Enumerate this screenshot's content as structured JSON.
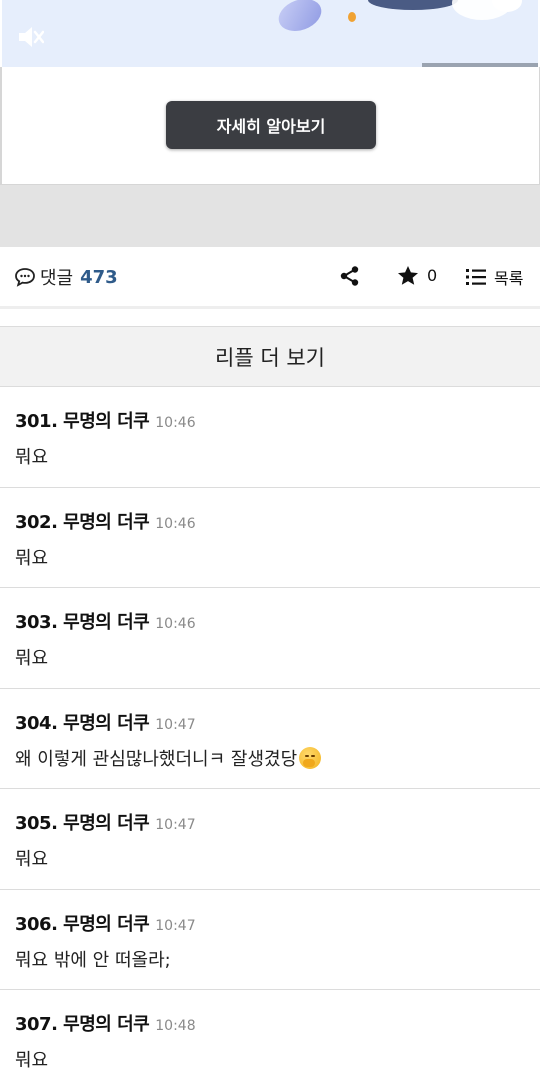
{
  "ad": {
    "button_label": "자세히 알아보기",
    "mute_icon": "mute-icon"
  },
  "toolbar": {
    "comment_label": "댓글",
    "comment_count": "473",
    "comment_icon": "comment-bubble-icon",
    "share_icon": "share-icon",
    "star_icon": "star-icon",
    "star_count": "0",
    "list_icon": "list-icon",
    "list_label": "목록"
  },
  "more_replies_label": "리플 더 보기",
  "comments": [
    {
      "title": "301. 무명의 더쿠",
      "time": "10:46",
      "text": "뭐요"
    },
    {
      "title": "302. 무명의 더쿠",
      "time": "10:46",
      "text": "뭐요"
    },
    {
      "title": "303. 무명의 더쿠",
      "time": "10:46",
      "text": "뭐요"
    },
    {
      "title": "304. 무명의 더쿠",
      "time": "10:47",
      "text": "왜 이렇게 관심많나했더니ㅋ 잘생겼당"
    },
    {
      "title": "305. 무명의 더쿠",
      "time": "10:47",
      "text": "뭐요"
    },
    {
      "title": "306. 무명의 더쿠",
      "time": "10:47",
      "text": "뭐요 밖에 안 떠올라;"
    },
    {
      "title": "307. 무명의 더쿠",
      "time": "10:48",
      "text": "뭐요"
    }
  ],
  "colors": {
    "accent_count": "#2f5b8a",
    "button_bg": "#3b3d42"
  }
}
